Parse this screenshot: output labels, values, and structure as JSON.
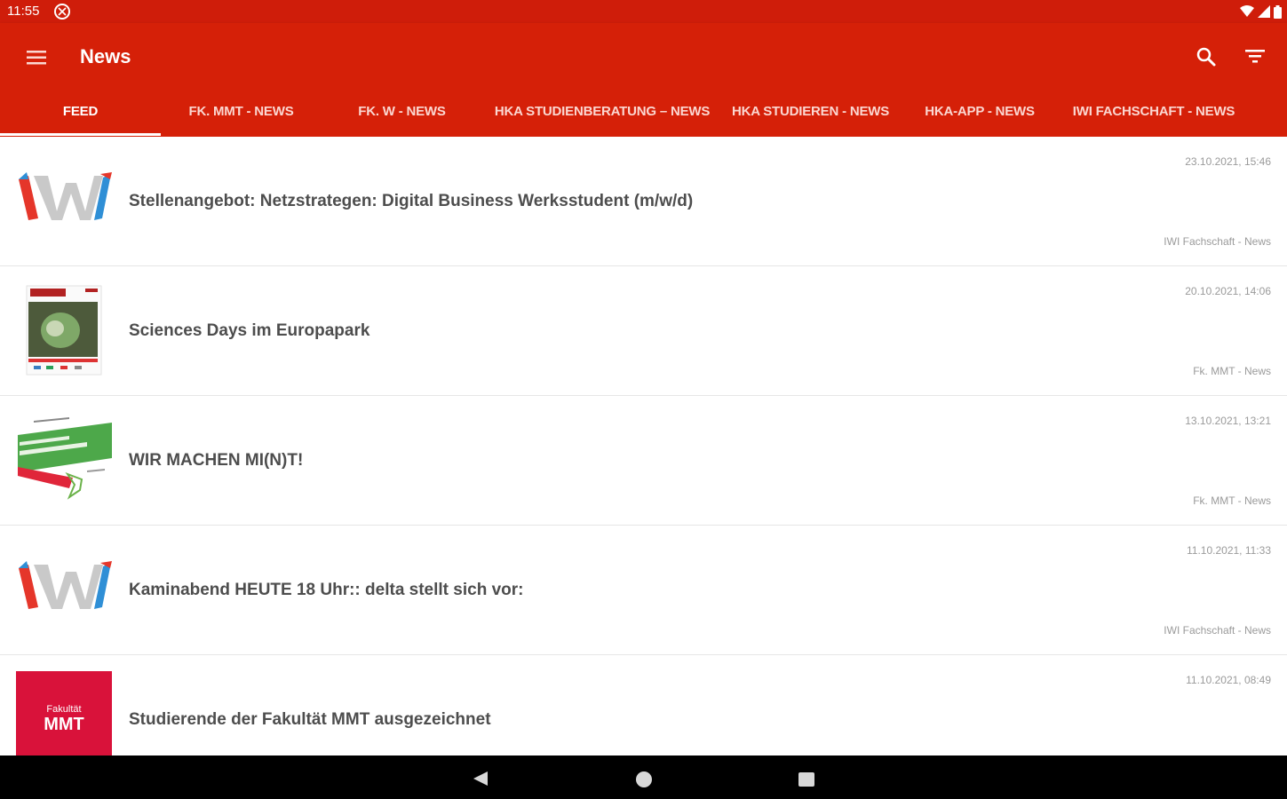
{
  "status_bar": {
    "time": "11:55"
  },
  "app_bar": {
    "title": "News"
  },
  "tabs": [
    {
      "label": "FEED"
    },
    {
      "label": "FK. MMT - NEWS"
    },
    {
      "label": "FK. W - NEWS"
    },
    {
      "label": "HKA STUDIENBERATUNG – NEWS"
    },
    {
      "label": "HKA STUDIEREN - NEWS"
    },
    {
      "label": "HKA-APP - NEWS"
    },
    {
      "label": "IWI FACHSCHAFT - NEWS"
    }
  ],
  "feed": [
    {
      "title": "Stellenangebot: Netzstrategen: Digital Business Werksstudent (m/w/d)",
      "date": "23.10.2021, 15:46",
      "source": "IWI Fachschaft - News",
      "thumb": "iwi-logo"
    },
    {
      "title": "Sciences Days im Europapark",
      "date": "20.10.2021, 14:06",
      "source": "Fk. MMT - News",
      "thumb": "science-days-poster"
    },
    {
      "title": "WIR MACHEN MI(N)T!",
      "date": "13.10.2021, 13:21",
      "source": "Fk. MMT - News",
      "thumb": "green-flyer"
    },
    {
      "title": "Kaminabend HEUTE 18 Uhr:: delta stellt sich vor:",
      "date": "11.10.2021, 11:33",
      "source": "IWI Fachschaft - News",
      "thumb": "iwi-logo"
    },
    {
      "title": "Studierende der Fakultät MMT ausgezeichnet",
      "date": "11.10.2021, 08:49",
      "source": "",
      "thumb": "mmt-logo",
      "thumb_text": {
        "line1": "Fakultät",
        "line2": "MMT"
      }
    }
  ],
  "colors": {
    "brand": "#d52008",
    "status_bar": "#cf1d0a",
    "mmt_red": "#d9123a"
  }
}
